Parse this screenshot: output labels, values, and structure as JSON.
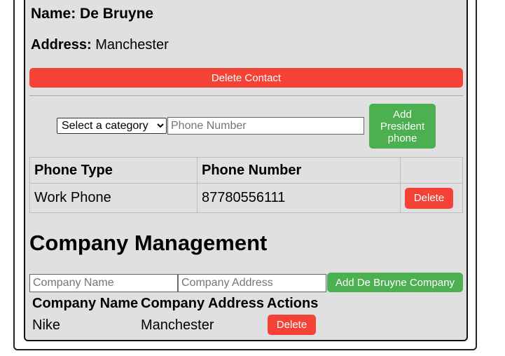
{
  "contact": {
    "name_label": "Name:",
    "name_value": "De Bruyne",
    "address_label": "Address:",
    "address_value": "Manchester",
    "delete_label": "Delete Contact"
  },
  "phone_form": {
    "category_selected": "Select a category",
    "phone_placeholder": "Phone Number",
    "add_label": "Add President phone"
  },
  "phone_table": {
    "headers": [
      "Phone Type",
      "Phone Number",
      ""
    ],
    "rows": [
      {
        "type": "Work Phone",
        "number": "87780556111",
        "action": "Delete"
      }
    ]
  },
  "company": {
    "heading": "Company Management",
    "name_placeholder": "Company Name",
    "address_placeholder": "Company Address",
    "add_label": "Add De Bruyne Company",
    "headers": [
      "Company Name",
      "Company Address",
      "Actions"
    ],
    "rows": [
      {
        "name": "Nike",
        "address": "Manchester",
        "action": "Delete"
      }
    ]
  },
  "colors": {
    "danger": "#f44336",
    "success": "#4caf50",
    "card_bg": "#e0e0e0"
  }
}
